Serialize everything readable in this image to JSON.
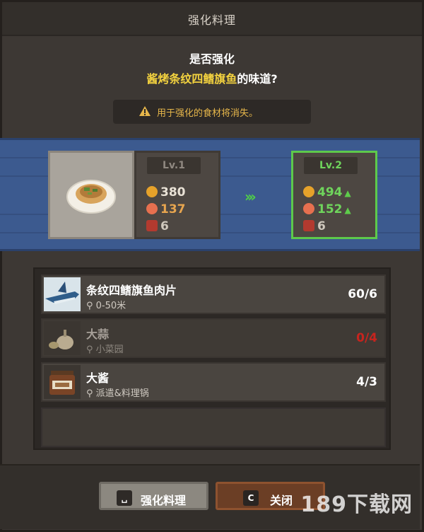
{
  "window": {
    "title": "强化料理"
  },
  "prompt": {
    "line1": "是否强化",
    "dish_name": "酱烤条纹四鳍旗鱼",
    "line2_suffix": "的味道?"
  },
  "warning": {
    "text": "用于强化的食材将消失。",
    "icon": "warning-icon"
  },
  "current_level": {
    "label": "Lv.1",
    "price": "380",
    "appeal": "137",
    "portions": "6"
  },
  "next_level": {
    "label": "Lv.2",
    "price": "494",
    "appeal": "152",
    "portions": "6"
  },
  "ingredients": [
    {
      "name": "条纹四鳍旗鱼肉片",
      "location": "0-50米",
      "count": "60/6",
      "sufficient": true,
      "icon": "marlin-icon"
    },
    {
      "name": "大蒜",
      "location": "小菜园",
      "count": "0/4",
      "sufficient": false,
      "icon": "garlic-icon"
    },
    {
      "name": "大酱",
      "location": "派遣&料理锅",
      "count": "4/3",
      "sufficient": true,
      "icon": "soybean-paste-jar-icon"
    }
  ],
  "buttons": {
    "enhance": {
      "label": "强化料理",
      "key": "␣"
    },
    "close": {
      "label": "关闭",
      "key": "C"
    }
  },
  "watermark": "189下载网",
  "colors": {
    "accent_green": "#5ecc4b",
    "dish_yellow": "#f3d23f",
    "warning_orange": "#e7b74b",
    "insufficient_red": "#c7241e",
    "band_blue": "#3c5a8f"
  }
}
